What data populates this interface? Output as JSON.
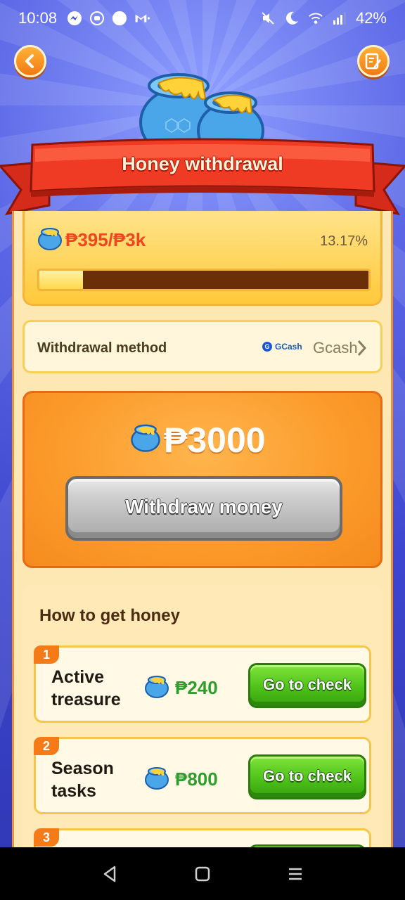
{
  "status_bar": {
    "time": "10:08",
    "battery": "42%",
    "left_icons": [
      "messenger-icon",
      "app-icon",
      "circle-icon",
      "gmail-icon"
    ],
    "right_icons": [
      "mute-icon",
      "moon-icon",
      "wifi-icon",
      "signal-icon"
    ]
  },
  "header": {
    "title": "Honey withdrawal",
    "back_icon": "back-arrow-icon",
    "edit_icon": "edit-icon"
  },
  "progress": {
    "current": "₱395",
    "separator": "/",
    "target": "₱3k",
    "percent_text": "13.17%",
    "percent_value": 13.17
  },
  "withdrawal_method": {
    "label": "Withdrawal method",
    "logo_text": "GCash",
    "value": "Gcash"
  },
  "withdraw": {
    "amount": "₱3000",
    "button_label": "Withdraw money"
  },
  "how_to": {
    "title": "How to get honey",
    "tasks": [
      {
        "number": "1",
        "name": "Active treasure",
        "reward": "₱240",
        "button": "Go to check"
      },
      {
        "number": "2",
        "name": "Season tasks",
        "reward": "₱800",
        "button": "Go to check"
      },
      {
        "number": "3",
        "name": "",
        "reward": "",
        "button": ""
      }
    ]
  },
  "colors": {
    "accent_orange": "#f58b1e",
    "reward_green": "#2f9d2c",
    "amount_red": "#f0451f"
  }
}
